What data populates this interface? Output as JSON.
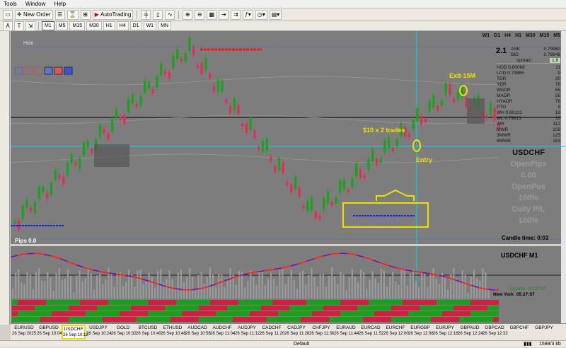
{
  "menu": {
    "items": [
      "Tools",
      "Window",
      "Help"
    ]
  },
  "toolbar": {
    "new_order": "New Order",
    "autotrading": "AutoTrading"
  },
  "timeframes": [
    "M1",
    "M5",
    "M15",
    "M30",
    "H1",
    "H4",
    "D1",
    "W1",
    "MN"
  ],
  "active_timeframe": "M1",
  "chart": {
    "hide_label": "Hide",
    "tf_buttons": [
      "W1",
      "D1",
      "H4",
      "H1",
      "M30",
      "M15",
      "M5"
    ],
    "level": "2.1",
    "pips_label": "Pips 0.0",
    "annotations": {
      "exit": "Exit-15M",
      "trades": "$10 x 2 trades",
      "entry": "Entry"
    },
    "colors": {
      "bull": "#20a020",
      "bear": "#e0305a",
      "cyan": "#00d8e8",
      "yellow": "#f0e000",
      "bg": "#7d7d7d"
    }
  },
  "info_panel": {
    "ask_label": "ASK",
    "ask": "0.79960",
    "bid_label": "BID",
    "bid": "0.79946",
    "spread_label": "spread :",
    "spread": "1.8",
    "rows": [
      {
        "k": "HOD 0.80068",
        "v": "11"
      },
      {
        "k": "LOD 0.79856",
        "v": "9"
      },
      {
        "k": "TDR",
        "v": "20"
      },
      {
        "k": "YDR",
        "v": "76"
      },
      {
        "k": "WADR",
        "v": "65"
      },
      {
        "k": "MADR",
        "v": "56"
      },
      {
        "k": "HYADR",
        "v": "76"
      },
      {
        "k": "PTO",
        "v": "5"
      },
      {
        "k": "WH 0.80131",
        "v": "19"
      },
      {
        "k": "WL 0.79613",
        "v": "33"
      },
      {
        "k": "WR",
        "v": "112"
      },
      {
        "k": "MWR",
        "v": "109"
      },
      {
        "k": "3MWR",
        "v": "125"
      },
      {
        "k": "6MWR",
        "v": "163"
      }
    ],
    "symbol": "USDCHF",
    "open_pips_label": "OpenPips",
    "open_pips": "0.00",
    "open_pos_label": "OpenPos",
    "open_pos": "100%",
    "daily_pl_label": "Daily P/L",
    "daily_pl": "100%",
    "candle_time_label": "Candle time:",
    "candle_time": "0:03"
  },
  "indicator": {
    "title": "USDCHF  M1",
    "london_label": "London",
    "london_time": "10:27:57",
    "newyork_label": "New York",
    "newyork_time": "05:27:57"
  },
  "symbol_tabs": [
    {
      "symbol": "EURUSD",
      "date": "26 Sep 2025"
    },
    {
      "symbol": "GBPUSD",
      "date": "26 Sep 10:04"
    },
    {
      "symbol": "USDCHF",
      "date": "26 Sep 10:12"
    },
    {
      "symbol": "USDJPY",
      "date": "26 Sep 10:24"
    },
    {
      "symbol": "GOLD",
      "date": "26 Sep 10:32"
    },
    {
      "symbol": "BTCUSD",
      "date": "26 Sep 10:40"
    },
    {
      "symbol": "ETHUSD",
      "date": "26 Sep 10:48"
    },
    {
      "symbol": "AUDCAD",
      "date": "26 Sep 10:56"
    },
    {
      "symbol": "AUDCHF",
      "date": "26 Sep 11:04"
    },
    {
      "symbol": "AUDJPY",
      "date": "26 Sep 11:12"
    },
    {
      "symbol": "CADCHF",
      "date": "26 Sep 11:20"
    },
    {
      "symbol": "CADJPY",
      "date": "26 Sep 11:28"
    },
    {
      "symbol": "CHFJPY",
      "date": "26 Sep 11:36"
    },
    {
      "symbol": "EURAUD",
      "date": "26 Sep 11:44"
    },
    {
      "symbol": "EURCAD",
      "date": "26 Sep 11:52"
    },
    {
      "symbol": "EURCHF",
      "date": "26 Sep 12:00"
    },
    {
      "symbol": "EURGBP",
      "date": "26 Sep 12:08"
    },
    {
      "symbol": "EURJPY",
      "date": "26 Sep 12:16"
    },
    {
      "symbol": "GBPAUD",
      "date": "26 Sep 12:24"
    },
    {
      "symbol": "GBPCAD",
      "date": "26 Sep 12:32"
    },
    {
      "symbol": "GBPCHF",
      "date": ""
    },
    {
      "symbol": "GBPJPY",
      "date": ""
    }
  ],
  "active_symbol": "USDCHF",
  "status": {
    "profile": "Default",
    "traffic": "1598/3 kb"
  }
}
